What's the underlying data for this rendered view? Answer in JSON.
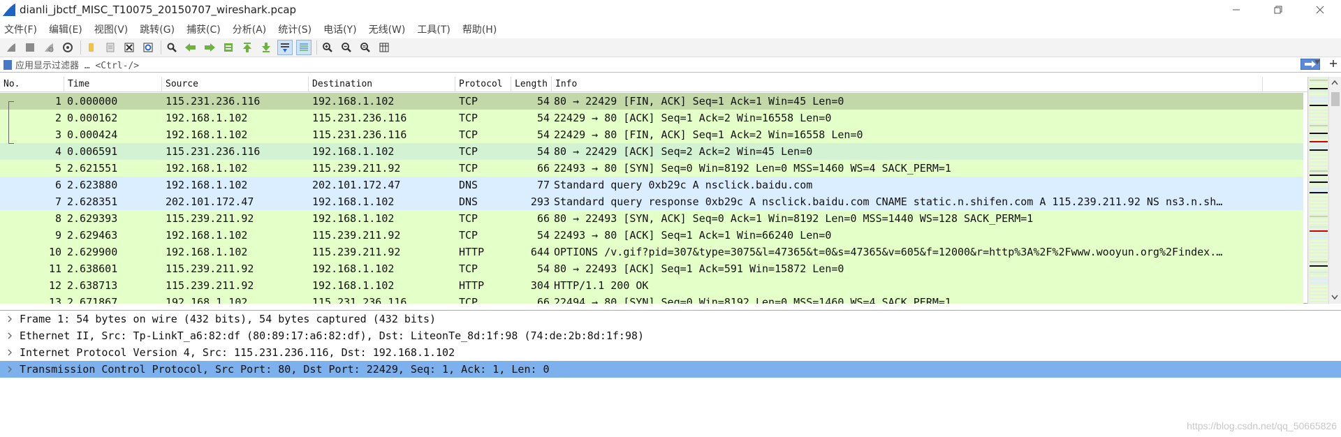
{
  "window": {
    "title": "dianli_jbctf_MISC_T10075_20150707_wireshark.pcap"
  },
  "menu": [
    "文件(F)",
    "编辑(E)",
    "视图(V)",
    "跳转(G)",
    "捕获(C)",
    "分析(A)",
    "统计(S)",
    "电话(Y)",
    "无线(W)",
    "工具(T)",
    "帮助(H)"
  ],
  "filter": {
    "placeholder": "应用显示过滤器 … <Ctrl-/>"
  },
  "columns": {
    "no": "No.",
    "time": "Time",
    "source": "Source",
    "destination": "Destination",
    "protocol": "Protocol",
    "length": "Length",
    "info": "Info"
  },
  "packets": [
    {
      "no": "1",
      "time": "0.000000",
      "src": "115.231.236.116",
      "dst": "192.168.1.102",
      "proto": "TCP",
      "len": "54",
      "info": "80 → 22429 [FIN, ACK] Seq=1 Ack=1 Win=45 Len=0",
      "color": "#c2d8a8"
    },
    {
      "no": "2",
      "time": "0.000162",
      "src": "192.168.1.102",
      "dst": "115.231.236.116",
      "proto": "TCP",
      "len": "54",
      "info": "22429 → 80 [ACK] Seq=1 Ack=2 Win=16558 Len=0",
      "color": "#e4ffc7"
    },
    {
      "no": "3",
      "time": "0.000424",
      "src": "192.168.1.102",
      "dst": "115.231.236.116",
      "proto": "TCP",
      "len": "54",
      "info": "22429 → 80 [FIN, ACK] Seq=1 Ack=2 Win=16558 Len=0",
      "color": "#e4ffc7"
    },
    {
      "no": "4",
      "time": "0.006591",
      "src": "115.231.236.116",
      "dst": "192.168.1.102",
      "proto": "TCP",
      "len": "54",
      "info": "80 → 22429 [ACK] Seq=2 Ack=2 Win=45 Len=0",
      "color": "#d3f2d3"
    },
    {
      "no": "5",
      "time": "2.621551",
      "src": "192.168.1.102",
      "dst": "115.239.211.92",
      "proto": "TCP",
      "len": "66",
      "info": "22493 → 80 [SYN] Seq=0 Win=8192 Len=0 MSS=1460 WS=4 SACK_PERM=1",
      "color": "#e4ffc7"
    },
    {
      "no": "6",
      "time": "2.623880",
      "src": "192.168.1.102",
      "dst": "202.101.172.47",
      "proto": "DNS",
      "len": "77",
      "info": "Standard query 0xb29c A nsclick.baidu.com",
      "color": "#daeeff"
    },
    {
      "no": "7",
      "time": "2.628351",
      "src": "202.101.172.47",
      "dst": "192.168.1.102",
      "proto": "DNS",
      "len": "293",
      "info": "Standard query response 0xb29c A nsclick.baidu.com CNAME static.n.shifen.com A 115.239.211.92 NS ns3.n.sh…",
      "color": "#daeeff"
    },
    {
      "no": "8",
      "time": "2.629393",
      "src": "115.239.211.92",
      "dst": "192.168.1.102",
      "proto": "TCP",
      "len": "66",
      "info": "80 → 22493 [SYN, ACK] Seq=0 Ack=1 Win=8192 Len=0 MSS=1440 WS=128 SACK_PERM=1",
      "color": "#e4ffc7"
    },
    {
      "no": "9",
      "time": "2.629463",
      "src": "192.168.1.102",
      "dst": "115.239.211.92",
      "proto": "TCP",
      "len": "54",
      "info": "22493 → 80 [ACK] Seq=1 Ack=1 Win=66240 Len=0",
      "color": "#e4ffc7"
    },
    {
      "no": "10",
      "time": "2.629900",
      "src": "192.168.1.102",
      "dst": "115.239.211.92",
      "proto": "HTTP",
      "len": "644",
      "info": "OPTIONS /v.gif?pid=307&type=3075&l=47365&t=0&s=47365&v=605&f=12000&r=http%3A%2F%2Fwww.wooyun.org%2Findex.…",
      "color": "#e4ffc7"
    },
    {
      "no": "11",
      "time": "2.638601",
      "src": "115.239.211.92",
      "dst": "192.168.1.102",
      "proto": "TCP",
      "len": "54",
      "info": "80 → 22493 [ACK] Seq=1 Ack=591 Win=15872 Len=0",
      "color": "#e4ffc7"
    },
    {
      "no": "12",
      "time": "2.638713",
      "src": "115.239.211.92",
      "dst": "192.168.1.102",
      "proto": "HTTP",
      "len": "304",
      "info": "HTTP/1.1 200 OK",
      "color": "#e4ffc7"
    },
    {
      "no": "13",
      "time": "2.671867",
      "src": "192.168.1.102",
      "dst": "115.231.236.116",
      "proto": "TCP",
      "len": "66",
      "info": "22494 → 80 [SYN] Seq=0 Win=8192 Len=0 MSS=1460 WS=4 SACK_PERM=1",
      "color": "#e4ffc7"
    }
  ],
  "details": [
    {
      "text": "Frame 1: 54 bytes on wire (432 bits), 54 bytes captured (432 bits)",
      "selected": false
    },
    {
      "text": "Ethernet II, Src: Tp-LinkT_a6:82:df (80:89:17:a6:82:df), Dst: LiteonTe_8d:1f:98 (74:de:2b:8d:1f:98)",
      "selected": false
    },
    {
      "text": "Internet Protocol Version 4, Src: 115.231.236.116, Dst: 192.168.1.102",
      "selected": false
    },
    {
      "text": "Transmission Control Protocol, Src Port: 80, Dst Port: 22429, Seq: 1, Ack: 1, Len: 0",
      "selected": true
    }
  ],
  "watermark": "https://blog.csdn.net/qq_50665826",
  "toolbar_icons": [
    "shark-fin-start-icon",
    "stop-icon",
    "restart-icon",
    "capture-options-icon",
    "open-file-icon",
    "save-file-icon",
    "close-file-icon",
    "reload-icon",
    "find-icon",
    "back-icon",
    "forward-icon",
    "go-to-packet-icon",
    "first-packet-icon",
    "last-packet-icon",
    "autoscroll-icon",
    "colorize-icon",
    "zoom-in-icon",
    "zoom-out-icon",
    "zoom-normal-icon",
    "resize-columns-icon"
  ]
}
